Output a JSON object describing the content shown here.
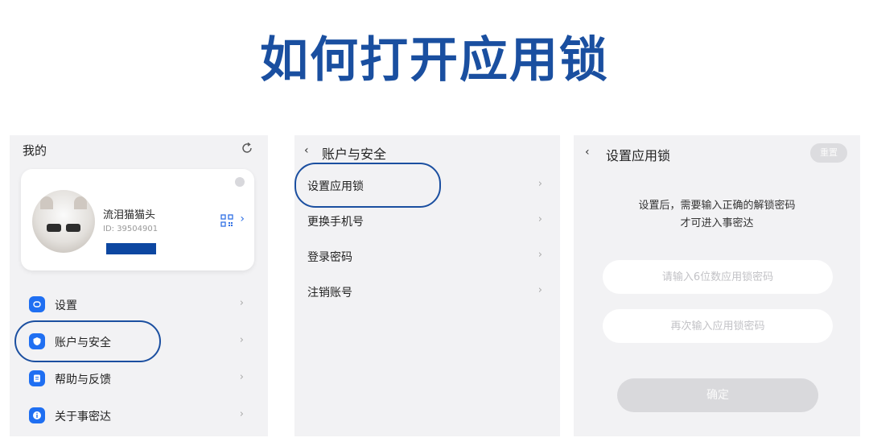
{
  "page_title": "如何打开应用锁",
  "colors": {
    "accent": "#1f6ff2",
    "title": "#1a4fa0",
    "highlight": "#1b4fa0"
  },
  "panel_mine": {
    "header": "我的",
    "header_icon": "refresh-icon",
    "profile": {
      "name": "流泪猫猫头",
      "id_text": "ID: 39504901",
      "qr_icon": "qr-code-icon"
    },
    "menu": [
      {
        "label": "设置",
        "icon": "settings-icon"
      },
      {
        "label": "账户与安全",
        "icon": "shield-icon"
      },
      {
        "label": "帮助与反馈",
        "icon": "document-icon"
      },
      {
        "label": "关于事密达",
        "icon": "info-icon"
      }
    ]
  },
  "panel_account": {
    "back": "‹",
    "title": "账户与安全",
    "items": [
      {
        "label": "设置应用锁"
      },
      {
        "label": "更换手机号"
      },
      {
        "label": "登录密码"
      },
      {
        "label": "注销账号"
      }
    ]
  },
  "panel_applock": {
    "back": "‹",
    "title": "设置应用锁",
    "reset_label": "重置",
    "description_line1": "设置后，需要输入正确的解锁密码",
    "description_line2": "才可进入事密达",
    "input1_placeholder": "请输入6位数应用锁密码",
    "input2_placeholder": "再次输入应用锁密码",
    "confirm_label": "确定"
  },
  "chevron": "›"
}
